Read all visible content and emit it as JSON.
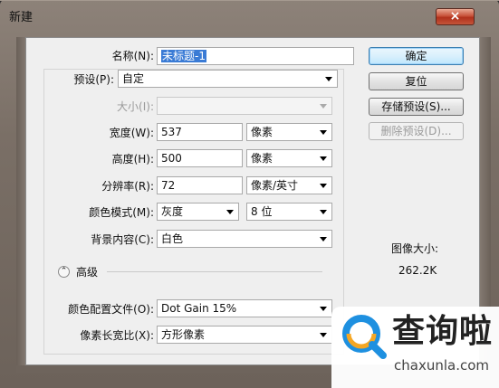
{
  "window": {
    "title": "新建",
    "close_glyph": "×"
  },
  "form": {
    "name": {
      "label": "名称(N):",
      "value": "未标题-1"
    },
    "preset": {
      "label": "预设(P):",
      "value": "自定"
    },
    "size": {
      "label": "大小(I):",
      "value": ""
    },
    "width": {
      "label": "宽度(W):",
      "value": "537",
      "unit": "像素"
    },
    "height": {
      "label": "高度(H):",
      "value": "500",
      "unit": "像素"
    },
    "resolution": {
      "label": "分辨率(R):",
      "value": "72",
      "unit": "像素/英寸"
    },
    "color_mode": {
      "label": "颜色模式(M):",
      "value": "灰度",
      "depth": "8 位"
    },
    "background": {
      "label": "背景内容(C):",
      "value": "白色"
    },
    "advanced": {
      "label": "高级",
      "toggle_glyph": "⌃"
    },
    "color_profile": {
      "label": "颜色配置文件(O):",
      "value": "Dot Gain 15%"
    },
    "pixel_aspect": {
      "label": "像素长宽比(X):",
      "value": "方形像素"
    }
  },
  "buttons": {
    "ok": "确定",
    "reset": "复位",
    "save_preset": "存储预设(S)...",
    "delete_preset": "删除预设(D)..."
  },
  "image_size": {
    "label": "图像大小:",
    "value": "262.2K"
  },
  "watermark": {
    "text": "查询啦",
    "url": "chaxunla.com",
    "logo_icon": "q-magnifier-icon"
  }
}
